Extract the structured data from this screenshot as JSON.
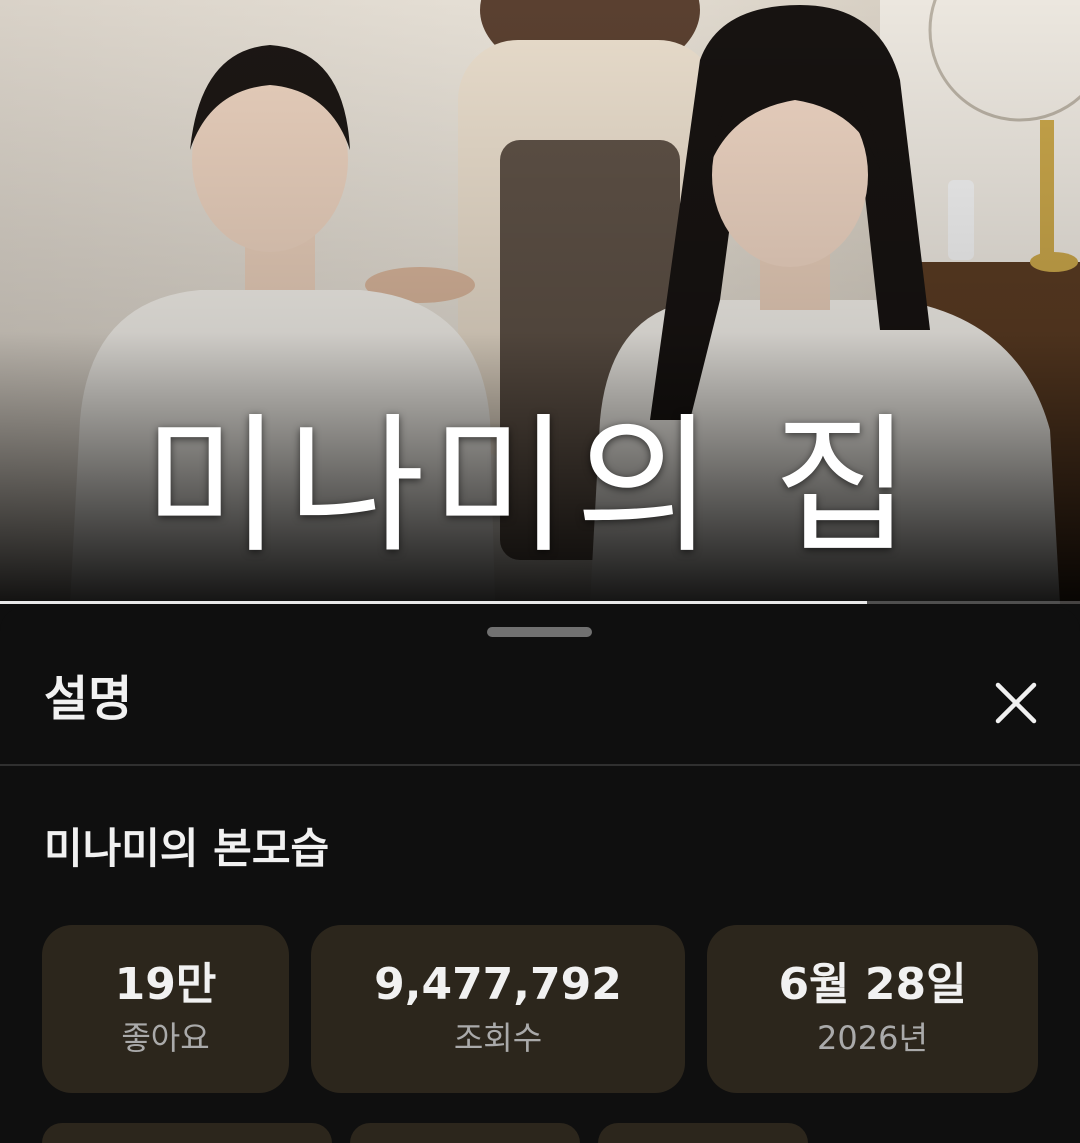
{
  "video": {
    "title_overlay": "미나미의 집",
    "progress_fraction": 0.803
  },
  "sheet": {
    "title": "설명",
    "close_icon": "close-icon",
    "video_heading": "미나미의 본모습",
    "stats": [
      {
        "value": "19만",
        "label": "좋아요"
      },
      {
        "value": "9,477,792",
        "label": "조회수"
      },
      {
        "value": "6월 28일",
        "label": "2026년"
      }
    ]
  },
  "colors": {
    "background": "#0f0f0f",
    "stat_card": "#2c261c",
    "secondary_text": "#aaaaaa"
  }
}
